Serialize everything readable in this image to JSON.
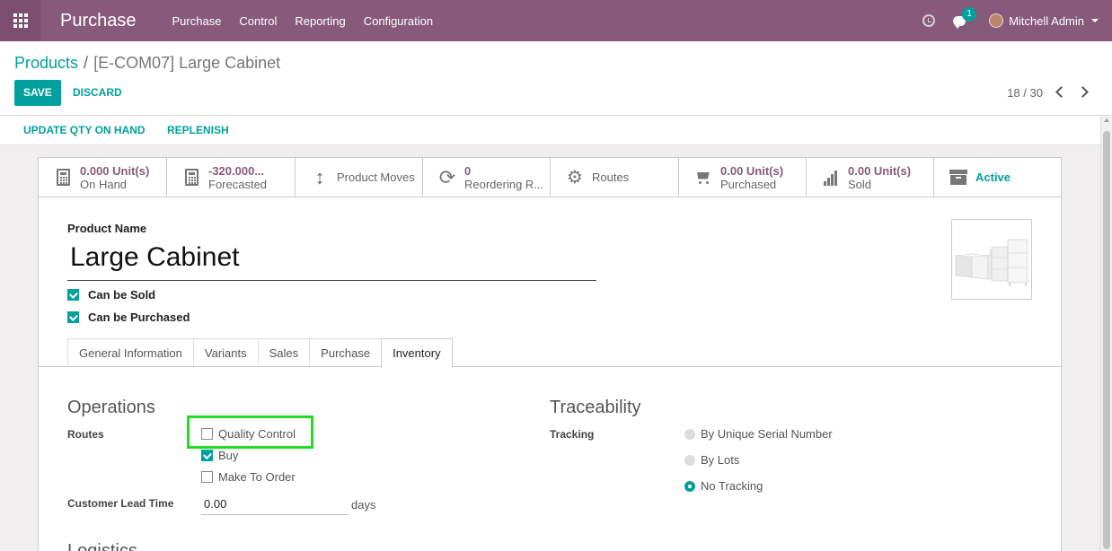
{
  "navbar": {
    "brand": "Purchase",
    "menu": [
      "Purchase",
      "Control",
      "Reporting",
      "Configuration"
    ],
    "chat_badge": "1",
    "user": "Mitchell Admin"
  },
  "breadcrumb": {
    "parent": "Products",
    "separator": "/",
    "current": "[E-COM07] Large Cabinet"
  },
  "buttons": {
    "save": "SAVE",
    "discard": "DISCARD",
    "update_qty": "UPDATE QTY ON HAND",
    "replenish": "REPLENISH"
  },
  "pager": {
    "value": "18 / 30"
  },
  "smart_buttons": [
    {
      "icon": "calculator-icon",
      "value": "0.000 Unit(s)",
      "label": "On Hand"
    },
    {
      "icon": "calculator-icon",
      "value": "-320.000...",
      "label": "Forecasted"
    },
    {
      "icon": "arrows-vertical-icon",
      "label": "Product Moves"
    },
    {
      "icon": "refresh-icon",
      "value": "0",
      "label": "Reordering R..."
    },
    {
      "icon": "gears-icon",
      "label": "Routes"
    },
    {
      "icon": "shopping-cart-icon",
      "value": "0.00 Unit(s)",
      "label": "Purchased"
    },
    {
      "icon": "signal-icon",
      "value": "0.00 Unit(s)",
      "label": "Sold"
    },
    {
      "icon": "archive-icon",
      "label": "Active"
    }
  ],
  "product": {
    "name_label": "Product Name",
    "name": "Large Cabinet",
    "can_be_sold": "Can be Sold",
    "can_be_purchased": "Can be Purchased"
  },
  "tabs": [
    "General Information",
    "Variants",
    "Sales",
    "Purchase",
    "Inventory"
  ],
  "active_tab": "Inventory",
  "operations": {
    "title": "Operations",
    "routes_label": "Routes",
    "routes": [
      {
        "label": "Quality Control",
        "checked": false
      },
      {
        "label": "Buy",
        "checked": true
      },
      {
        "label": "Make To Order",
        "checked": false
      }
    ],
    "lead_time_label": "Customer Lead Time",
    "lead_time_value": "0.00",
    "lead_time_unit": "days"
  },
  "traceability": {
    "title": "Traceability",
    "tracking_label": "Tracking",
    "options": [
      {
        "label": "By Unique Serial Number",
        "selected": false
      },
      {
        "label": "By Lots",
        "selected": false
      },
      {
        "label": "No Tracking",
        "selected": true
      }
    ]
  },
  "logistics": {
    "title": "Logistics"
  },
  "colors": {
    "brand": "#875a7b",
    "accent": "#00a09d"
  }
}
